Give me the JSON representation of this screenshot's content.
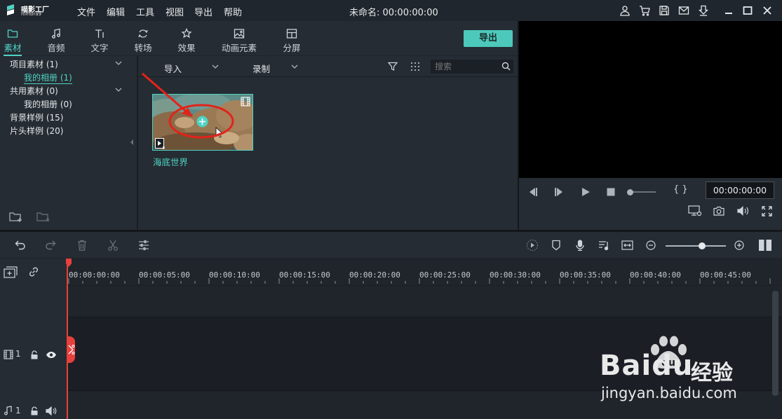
{
  "app": {
    "logo_cn": "喵影工厂",
    "logo_en": "filmora9",
    "project_title": "未命名: 00:00:00:00"
  },
  "menu": [
    "文件",
    "编辑",
    "工具",
    "视图",
    "导出",
    "帮助"
  ],
  "window_icons": [
    "user-icon",
    "cart-icon",
    "save-icon",
    "mail-icon",
    "download-icon",
    "minimize-icon",
    "maximize-icon",
    "close-icon"
  ],
  "tabs": [
    {
      "label": "素材",
      "icon": "folder-icon",
      "active": true
    },
    {
      "label": "音频",
      "icon": "music-note-icon"
    },
    {
      "label": "文字",
      "icon": "text-icon"
    },
    {
      "label": "转场",
      "icon": "transition-icon"
    },
    {
      "label": "效果",
      "icon": "effects-icon"
    },
    {
      "label": "动画元素",
      "icon": "image-icon"
    },
    {
      "label": "分屏",
      "icon": "split-screen-icon"
    }
  ],
  "export_label": "导出",
  "tree": [
    {
      "label": "项目素材 (1)",
      "expanded": true
    },
    {
      "label": "我的相册 (1)",
      "selected": true
    },
    {
      "label": "共用素材 (0)",
      "expanded": true
    },
    {
      "label": "我的相册 (0)"
    },
    {
      "label": "背景样例 (15)"
    },
    {
      "label": "片头样例 (20)"
    }
  ],
  "library": {
    "import_label": "导入",
    "record_label": "录制",
    "search_placeholder": "搜索",
    "item_name": "海底世界"
  },
  "preview": {
    "timecode": "00:00:00:00",
    "bracket_label": "{  }"
  },
  "ruler_labels": [
    "00:00:00:00",
    "00:00:05:00",
    "00:00:10:00",
    "00:00:15:00",
    "00:00:20:00",
    "00:00:25:00",
    "00:00:30:00",
    "00:00:35:00",
    "00:00:40:00",
    "00:00:45:00"
  ],
  "tracks": [
    {
      "number": "1",
      "type": "video"
    },
    {
      "number": "1",
      "type": "audio"
    }
  ],
  "colors": {
    "accent": "#4fd3c4",
    "export_button": "#4dc9bb",
    "playhead": "#e8403c",
    "annotation": "#e2231a"
  },
  "watermark": {
    "brand": "Baidu",
    "cn": "经验",
    "url": "jingyan.baidu.com"
  }
}
